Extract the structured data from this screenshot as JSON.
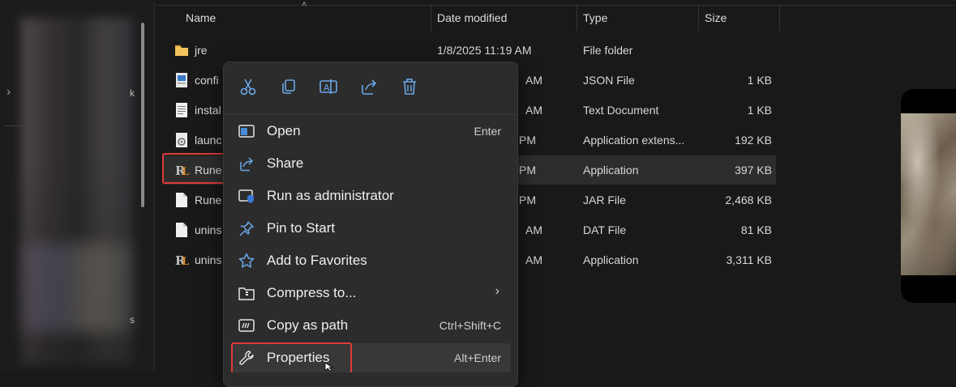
{
  "columns": {
    "name": "Name",
    "date": "Date modified",
    "type": "Type",
    "size": "Size"
  },
  "nav": {
    "partial_k": "k",
    "partial_s": "s"
  },
  "files": [
    {
      "name": "jre",
      "date": "1/8/2025 11:19 AM",
      "type": "File folder",
      "size": "",
      "icon": "folder-icon"
    },
    {
      "name": "confi",
      "date": "AM",
      "type": "JSON File",
      "size": "1 KB",
      "icon": "json-file-icon"
    },
    {
      "name": "instal",
      "date": "AM",
      "type": "Text Document",
      "size": "1 KB",
      "icon": "text-file-icon"
    },
    {
      "name": "launc",
      "date": "PM",
      "type": "Application extens...",
      "size": "192 KB",
      "icon": "dll-file-icon"
    },
    {
      "name": "Rune",
      "date": "PM",
      "type": "Application",
      "size": "397 KB",
      "icon": "runelite-app-icon"
    },
    {
      "name": "Rune",
      "date": "PM",
      "type": "JAR File",
      "size": "2,468 KB",
      "icon": "blank-file-icon"
    },
    {
      "name": "unins",
      "date": "AM",
      "type": "DAT File",
      "size": "81 KB",
      "icon": "blank-file-icon"
    },
    {
      "name": "unins",
      "date": "AM",
      "type": "Application",
      "size": "3,311 KB",
      "icon": "runelite-app-icon"
    }
  ],
  "context_menu": {
    "toolbar": [
      "cut-icon",
      "copy-icon",
      "rename-icon",
      "share-icon",
      "delete-icon"
    ],
    "items": [
      {
        "label": "Open",
        "shortcut": "Enter",
        "icon": "open-app-icon"
      },
      {
        "label": "Share",
        "shortcut": "",
        "icon": "share-icon"
      },
      {
        "label": "Run as administrator",
        "shortcut": "",
        "icon": "admin-shield-icon"
      },
      {
        "label": "Pin to Start",
        "shortcut": "",
        "icon": "pin-icon"
      },
      {
        "label": "Add to Favorites",
        "shortcut": "",
        "icon": "star-icon"
      },
      {
        "label": "Compress to...",
        "shortcut": "",
        "icon": "zip-folder-icon",
        "submenu": true
      },
      {
        "label": "Copy as path",
        "shortcut": "Ctrl+Shift+C",
        "icon": "copy-path-icon"
      },
      {
        "label": "Properties",
        "shortcut": "Alt+Enter",
        "icon": "wrench-icon"
      }
    ]
  },
  "colors": {
    "accent": "#6aa8ea",
    "highlight": "#e03a3a",
    "menu_bg": "#2c2c2c",
    "window_bg": "#191919"
  }
}
